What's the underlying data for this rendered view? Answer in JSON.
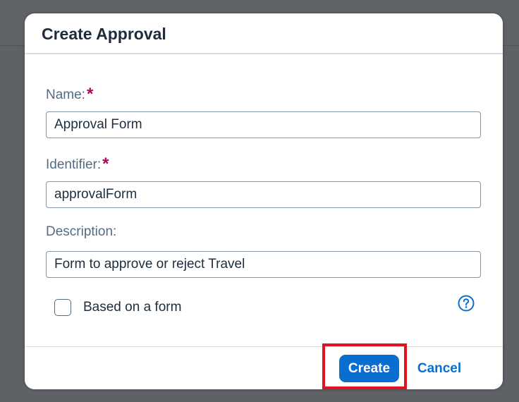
{
  "dialog": {
    "title": "Create Approval"
  },
  "form": {
    "name_label": "Name:",
    "name_value": "Approval Form",
    "identifier_label": "Identifier:",
    "identifier_value": "approvalForm",
    "description_label": "Description:",
    "description_value": "Form to approve or reject Travel",
    "required_marker": "*",
    "based_on_form_label": "Based on a form",
    "based_on_form_checked": false
  },
  "footer": {
    "create_label": "Create",
    "cancel_label": "Cancel"
  },
  "icons": {
    "help": "question-circle-icon"
  },
  "colors": {
    "accent": "#0a6ed1",
    "required": "#aa0a5a",
    "highlight": "#e0141e",
    "overlay": "#5e6165"
  }
}
